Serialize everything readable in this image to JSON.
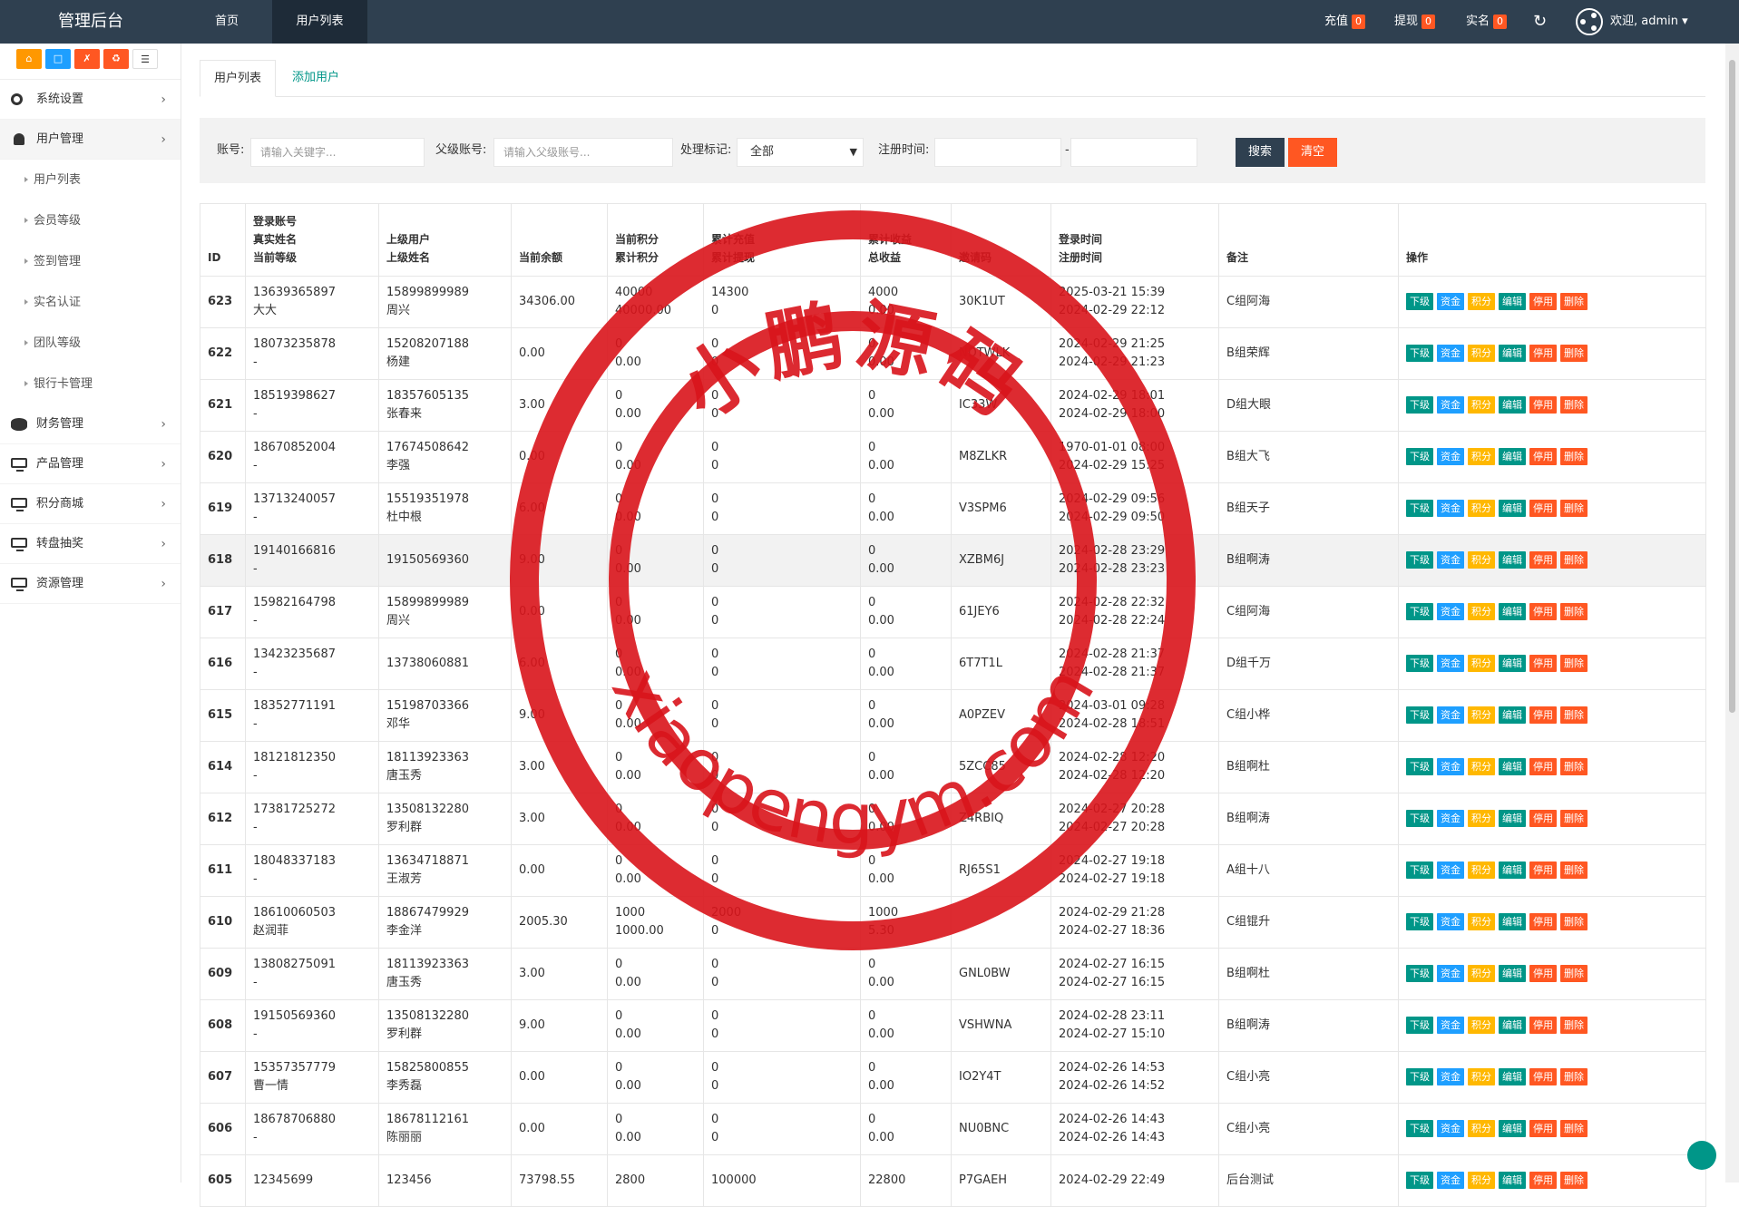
{
  "brand": "管理后台",
  "nav": {
    "home": "首页",
    "users": "用户列表"
  },
  "topbar": {
    "recharge": {
      "label": "充值",
      "count": "0"
    },
    "withdraw": {
      "label": "提现",
      "count": "0"
    },
    "realname": {
      "label": "实名",
      "count": "0"
    },
    "refresh_icon": "refresh-icon",
    "welcome": "欢迎, admin ▾"
  },
  "quick_buttons": [
    {
      "icon": "home-icon",
      "color": "#ff9800"
    },
    {
      "icon": "file-icon",
      "color": "#1e9fff"
    },
    {
      "icon": "trash-icon",
      "color": "#ff5722"
    },
    {
      "icon": "recycle-icon",
      "color": "#ff5722"
    },
    {
      "icon": "list-icon",
      "color": "#ffffff"
    }
  ],
  "sidebar": {
    "system": "系统设置",
    "users": "用户管理",
    "user_sub": [
      "用户列表",
      "会员等级",
      "签到管理",
      "实名认证",
      "团队等级",
      "银行卡管理"
    ],
    "finance": "财务管理",
    "products": "产品管理",
    "points_mall": "积分商城",
    "lottery": "转盘抽奖",
    "resources": "资源管理"
  },
  "tabs": {
    "list": "用户列表",
    "add": "添加用户"
  },
  "search": {
    "account_label": "账号:",
    "account_placeholder": "请输入关键字...",
    "parent_label": "父级账号:",
    "parent_placeholder": "请输入父级账号...",
    "flag_label": "处理标记:",
    "flag_value": "全部",
    "regtime_label": "注册时间:",
    "dash": "-",
    "search_btn": "搜索",
    "clear_btn": "清空"
  },
  "table": {
    "headers": {
      "id": "ID",
      "account": [
        "登录账号",
        "真实姓名",
        "当前等级"
      ],
      "parent": [
        "上级用户",
        "上级姓名"
      ],
      "balance": "当前余额",
      "points": [
        "当前积分",
        "累计积分"
      ],
      "recharge": [
        "累计充值",
        "累计提现"
      ],
      "earnings": [
        "累计收益",
        "总收益"
      ],
      "invite": "邀请码",
      "time": [
        "登录时间",
        "注册时间"
      ],
      "remark": "备注",
      "ops": "操作"
    },
    "op_labels": [
      "下级",
      "资金",
      "积分",
      "编辑",
      "停用",
      "删除"
    ],
    "rows": [
      {
        "id": "623",
        "acc": "13639365897",
        "name": "大大",
        "pacc": "15899899989",
        "pname": "周兴",
        "bal": "34306.00",
        "pt1": "40000",
        "pt2": "40000.00",
        "rc1": "14300",
        "rc2": "0",
        "er1": "4000",
        "er2": "0.00",
        "code": "30K1UT",
        "t1": "2025-03-21 15:39",
        "t2": "2024-02-29 22:12",
        "remark": "C组阿海",
        "hl": false
      },
      {
        "id": "622",
        "acc": "18073235878",
        "name": "-",
        "pacc": "15208207188",
        "pname": "杨建",
        "bal": "0.00",
        "pt1": "0",
        "pt2": "0.00",
        "rc1": "0",
        "rc2": "0",
        "er1": "0",
        "er2": "0.00",
        "code": "NDTWLK",
        "t1": "2024-02-29 21:25",
        "t2": "2024-02-29 21:23",
        "remark": "B组荣辉",
        "hl": false
      },
      {
        "id": "621",
        "acc": "18519398627",
        "name": "-",
        "pacc": "18357605135",
        "pname": "张春来",
        "bal": "3.00",
        "pt1": "0",
        "pt2": "0.00",
        "rc1": "0",
        "rc2": "0",
        "er1": "0",
        "er2": "0.00",
        "code": "IC33W",
        "t1": "2024-02-29 18:01",
        "t2": "2024-02-29 18:00",
        "remark": "D组大眼",
        "hl": false
      },
      {
        "id": "620",
        "acc": "18670852004",
        "name": "-",
        "pacc": "17674508642",
        "pname": "李强",
        "bal": "0.00",
        "pt1": "0",
        "pt2": "0.00",
        "rc1": "0",
        "rc2": "0",
        "er1": "0",
        "er2": "0.00",
        "code": "M8ZLKR",
        "t1": "1970-01-01 08:00",
        "t2": "2024-02-29 15:25",
        "remark": "B组大飞",
        "hl": false
      },
      {
        "id": "619",
        "acc": "13713240057",
        "name": "-",
        "pacc": "15519351978",
        "pname": "杜中根",
        "bal": "6.00",
        "pt1": "0",
        "pt2": "0.00",
        "rc1": "0",
        "rc2": "0",
        "er1": "0",
        "er2": "0.00",
        "code": "V3SPM6",
        "t1": "2024-02-29 09:56",
        "t2": "2024-02-29 09:50",
        "remark": "B组天子",
        "hl": false
      },
      {
        "id": "618",
        "acc": "19140166816",
        "name": "-",
        "pacc": "19150569360",
        "pname": "",
        "bal": "9.00",
        "pt1": "0",
        "pt2": "0.00",
        "rc1": "0",
        "rc2": "0",
        "er1": "0",
        "er2": "0.00",
        "code": "XZBM6J",
        "t1": "2024-02-28 23:29",
        "t2": "2024-02-28 23:23",
        "remark": "B组啊涛",
        "hl": true
      },
      {
        "id": "617",
        "acc": "15982164798",
        "name": "-",
        "pacc": "15899899989",
        "pname": "周兴",
        "bal": "0.00",
        "pt1": "0",
        "pt2": "0.00",
        "rc1": "0",
        "rc2": "0",
        "er1": "0",
        "er2": "0.00",
        "code": "61JEY6",
        "t1": "2024-02-28 22:32",
        "t2": "2024-02-28 22:24",
        "remark": "C组阿海",
        "hl": false
      },
      {
        "id": "616",
        "acc": "13423235687",
        "name": "-",
        "pacc": "13738060881",
        "pname": "",
        "bal": "6.00",
        "pt1": "0",
        "pt2": "0.00",
        "rc1": "0",
        "rc2": "0",
        "er1": "0",
        "er2": "0.00",
        "code": "6T7T1L",
        "t1": "2024-02-28 21:37",
        "t2": "2024-02-28 21:37",
        "remark": "D组千万",
        "hl": false
      },
      {
        "id": "615",
        "acc": "18352771191",
        "name": "-",
        "pacc": "15198703366",
        "pname": "邓华",
        "bal": "9.00",
        "pt1": "0",
        "pt2": "0.00",
        "rc1": "0",
        "rc2": "0",
        "er1": "0",
        "er2": "0.00",
        "code": "A0PZEV",
        "t1": "2024-03-01 09:28",
        "t2": "2024-02-28 18:51",
        "remark": "C组小桦",
        "hl": false
      },
      {
        "id": "614",
        "acc": "18121812350",
        "name": "-",
        "pacc": "18113923363",
        "pname": "唐玉秀",
        "bal": "3.00",
        "pt1": "0",
        "pt2": "0.00",
        "rc1": "0",
        "rc2": "0",
        "er1": "0",
        "er2": "0.00",
        "code": "5ZCC85",
        "t1": "2024-02-28 12:20",
        "t2": "2024-02-28 12:20",
        "remark": "B组啊杜",
        "hl": false
      },
      {
        "id": "612",
        "acc": "17381725272",
        "name": "-",
        "pacc": "13508132280",
        "pname": "罗利群",
        "bal": "3.00",
        "pt1": "0",
        "pt2": "0.00",
        "rc1": "0",
        "rc2": "0",
        "er1": "0",
        "er2": "0.00",
        "code": "Z4RBIQ",
        "t1": "2024-02-27 20:28",
        "t2": "2024-02-27 20:28",
        "remark": "B组啊涛",
        "hl": false
      },
      {
        "id": "611",
        "acc": "18048337183",
        "name": "-",
        "pacc": "13634718871",
        "pname": "王淑芳",
        "bal": "0.00",
        "pt1": "0",
        "pt2": "0.00",
        "rc1": "0",
        "rc2": "0",
        "er1": "0",
        "er2": "0.00",
        "code": "RJ65S1",
        "t1": "2024-02-27 19:18",
        "t2": "2024-02-27 19:18",
        "remark": "A组十八",
        "hl": false
      },
      {
        "id": "610",
        "acc": "18610060503",
        "name": "赵润菲",
        "pacc": "18867479929",
        "pname": "李金洋",
        "bal": "2005.30",
        "pt1": "1000",
        "pt2": "1000.00",
        "rc1": "2000",
        "rc2": "0",
        "er1": "1000",
        "er2": "5.30",
        "code": "",
        "t1": "2024-02-29 21:28",
        "t2": "2024-02-27 18:36",
        "remark": "C组锟升",
        "hl": false
      },
      {
        "id": "609",
        "acc": "13808275091",
        "name": "-",
        "pacc": "18113923363",
        "pname": "唐玉秀",
        "bal": "3.00",
        "pt1": "0",
        "pt2": "0.00",
        "rc1": "0",
        "rc2": "0",
        "er1": "0",
        "er2": "0.00",
        "code": "GNL0BW",
        "t1": "2024-02-27 16:15",
        "t2": "2024-02-27 16:15",
        "remark": "B组啊杜",
        "hl": false
      },
      {
        "id": "608",
        "acc": "19150569360",
        "name": "-",
        "pacc": "13508132280",
        "pname": "罗利群",
        "bal": "9.00",
        "pt1": "0",
        "pt2": "0.00",
        "rc1": "0",
        "rc2": "0",
        "er1": "0",
        "er2": "0.00",
        "code": "VSHWNA",
        "t1": "2024-02-28 23:11",
        "t2": "2024-02-27 15:10",
        "remark": "B组啊涛",
        "hl": false
      },
      {
        "id": "607",
        "acc": "15357357779",
        "name": "曹一情",
        "pacc": "15825800855",
        "pname": "李秀磊",
        "bal": "0.00",
        "pt1": "0",
        "pt2": "0.00",
        "rc1": "0",
        "rc2": "0",
        "er1": "0",
        "er2": "0.00",
        "code": "IO2Y4T",
        "t1": "2024-02-26 14:53",
        "t2": "2024-02-26 14:52",
        "remark": "C组小亮",
        "hl": false
      },
      {
        "id": "606",
        "acc": "18678706880",
        "name": "-",
        "pacc": "18678112161",
        "pname": "陈丽丽",
        "bal": "0.00",
        "pt1": "0",
        "pt2": "0.00",
        "rc1": "0",
        "rc2": "0",
        "er1": "0",
        "er2": "0.00",
        "code": "NU0BNC",
        "t1": "2024-02-26 14:43",
        "t2": "2024-02-26 14:43",
        "remark": "C组小亮",
        "hl": false
      },
      {
        "id": "605",
        "acc": "12345699",
        "name": "",
        "pacc": "123456",
        "pname": "",
        "bal": "73798.55",
        "pt1": "2800",
        "pt2": "",
        "rc1": "100000",
        "rc2": "",
        "er1": "22800",
        "er2": "",
        "code": "P7GAEH",
        "t1": "2024-02-29 22:49",
        "t2": "",
        "remark": "后台测试",
        "hl": false
      }
    ]
  },
  "watermark": {
    "text_cn": "小鹏源码",
    "text_en": "xiaopengym.com",
    "color": "#d9141b"
  }
}
